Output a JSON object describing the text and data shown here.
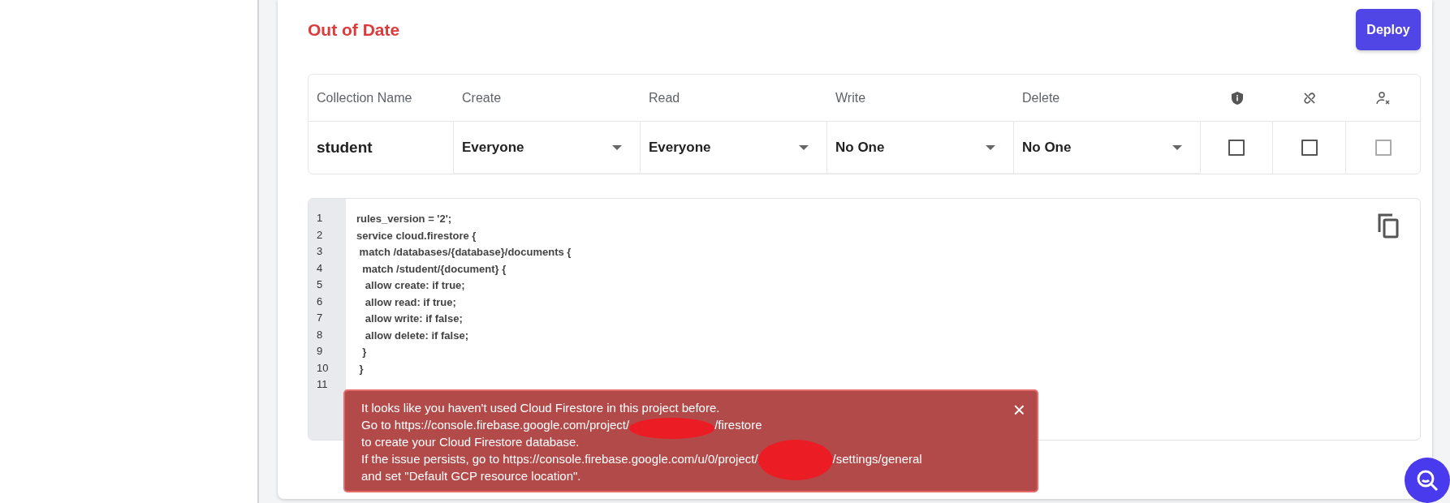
{
  "section": {
    "title": "Out of Date",
    "deploy_button": "Deploy"
  },
  "table": {
    "columns": [
      {
        "kind": "text",
        "label": "Collection Name"
      },
      {
        "kind": "text",
        "label": "Create"
      },
      {
        "kind": "text",
        "label": "Read"
      },
      {
        "kind": "text",
        "label": "Write"
      },
      {
        "kind": "text",
        "label": "Delete"
      },
      {
        "kind": "icon"
      },
      {
        "kind": "icon"
      },
      {
        "kind": "icon"
      }
    ],
    "rows": [
      {
        "name": "student",
        "permissions": [
          "Everyone",
          "Everyone",
          "No One",
          "No One"
        ],
        "flags": [
          {
            "checked": false,
            "disabled": false
          },
          {
            "checked": false,
            "disabled": false
          },
          {
            "checked": false,
            "disabled": true
          }
        ]
      }
    ]
  },
  "editor": {
    "lines": [
      {
        "number": "1",
        "text": "rules_version = '2';"
      },
      {
        "number": "2",
        "text": "service cloud.firestore {"
      },
      {
        "number": "3",
        "text": " match /databases/{database}/documents {"
      },
      {
        "number": "4",
        "text": "  match /student/{document} {"
      },
      {
        "number": "5",
        "text": "   allow create: if true;"
      },
      {
        "number": "6",
        "text": "   allow read: if true;"
      },
      {
        "number": "7",
        "text": "   allow write: if false;"
      },
      {
        "number": "8",
        "text": "   allow delete: if false;"
      },
      {
        "number": "9",
        "text": "  }"
      },
      {
        "number": "10",
        "text": " }"
      },
      {
        "number": "11"
      }
    ]
  },
  "toast": {
    "close": "×",
    "lines": [
      {
        "parts": [
          "It looks like you haven't used Cloud Firestore in this project before."
        ]
      },
      {
        "parts": [
          "Go to https://console.firebase.google.com/project/",
          "/firestore"
        ]
      },
      {
        "parts": [
          "to create your Cloud Firestore database."
        ]
      },
      {
        "parts": [
          "If the issue persists, go to https://console.firebase.google.com/u/0/project/",
          "/settings/general"
        ]
      },
      {
        "parts": [
          "and set \"Default GCP resource location\"."
        ]
      }
    ]
  }
}
